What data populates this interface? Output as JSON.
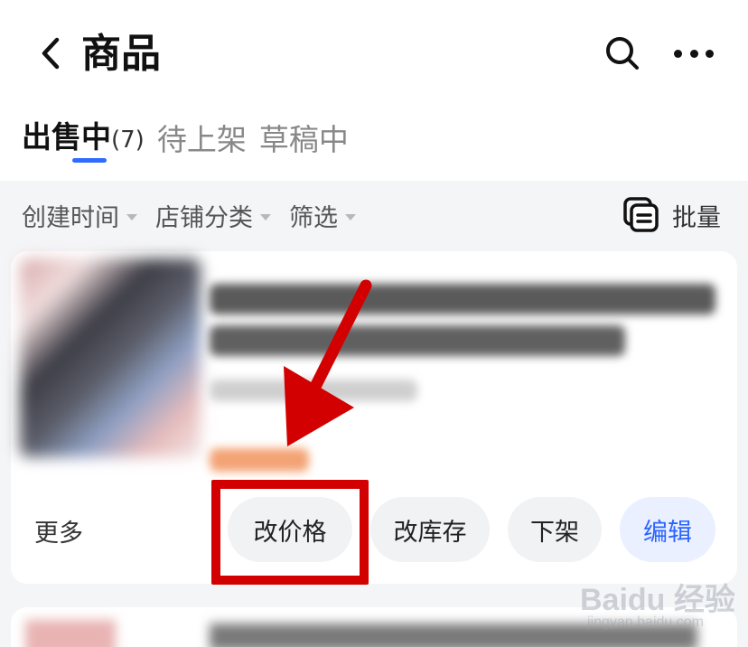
{
  "header": {
    "title": "商品",
    "back_icon": "chevron-left-icon",
    "search_icon": "search-icon",
    "more_icon": "more-horizontal-icon"
  },
  "tabs": [
    {
      "label": "出售中",
      "count": "(7)",
      "active": true
    },
    {
      "label": "待上架",
      "active": false
    },
    {
      "label": "草稿中",
      "active": false
    }
  ],
  "filters": [
    {
      "label": "创建时间"
    },
    {
      "label": "店铺分类"
    },
    {
      "label": "筛选"
    }
  ],
  "batch": {
    "label": "批量",
    "icon": "batch-list-icon"
  },
  "product_card": {
    "more_label": "更多",
    "actions": [
      {
        "label": "改价格"
      },
      {
        "label": "改库存"
      },
      {
        "label": "下架"
      },
      {
        "label": "编辑"
      }
    ]
  },
  "watermark": {
    "brand": "Baidu 经验",
    "sub": "jingyan.baidu.com"
  },
  "colors": {
    "accent": "#2f6bff",
    "edit_text": "#2b64ff",
    "annotation_red": "#d20000",
    "price_orange": "#f3a374"
  }
}
